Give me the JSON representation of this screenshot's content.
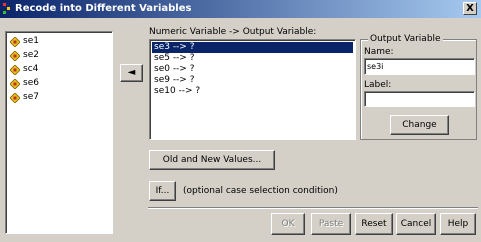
{
  "window": {
    "title": "Recode into Different Variables",
    "close_label": "X"
  },
  "source_variables": [
    "se1",
    "se2",
    "sc4",
    "se6",
    "se7"
  ],
  "move_button": {
    "label": "◄"
  },
  "mapping": {
    "header_label": "Numeric Variable -> Output Variable:",
    "items": [
      "se3 --> ?",
      "se5 --> ?",
      "se0 --> ?",
      "se9 --> ?",
      "se10 --> ?"
    ],
    "selected_index": 0
  },
  "output_variable": {
    "group_title": "Output Variable",
    "name_label": "Name:",
    "name_value": "se3i",
    "label_label": "Label:",
    "label_value": "",
    "change_button": "Change"
  },
  "buttons": {
    "old_new": "Old and New Values...",
    "if": "If...",
    "if_note": "(optional case selection condition)",
    "ok": "OK",
    "paste": "Paste",
    "reset": "Reset",
    "cancel": "Cancel",
    "help": "Help"
  },
  "colors": {
    "title_bar": "#0a246a",
    "selection": "#0a246a",
    "dialog_bg": "#d4d0c8"
  }
}
